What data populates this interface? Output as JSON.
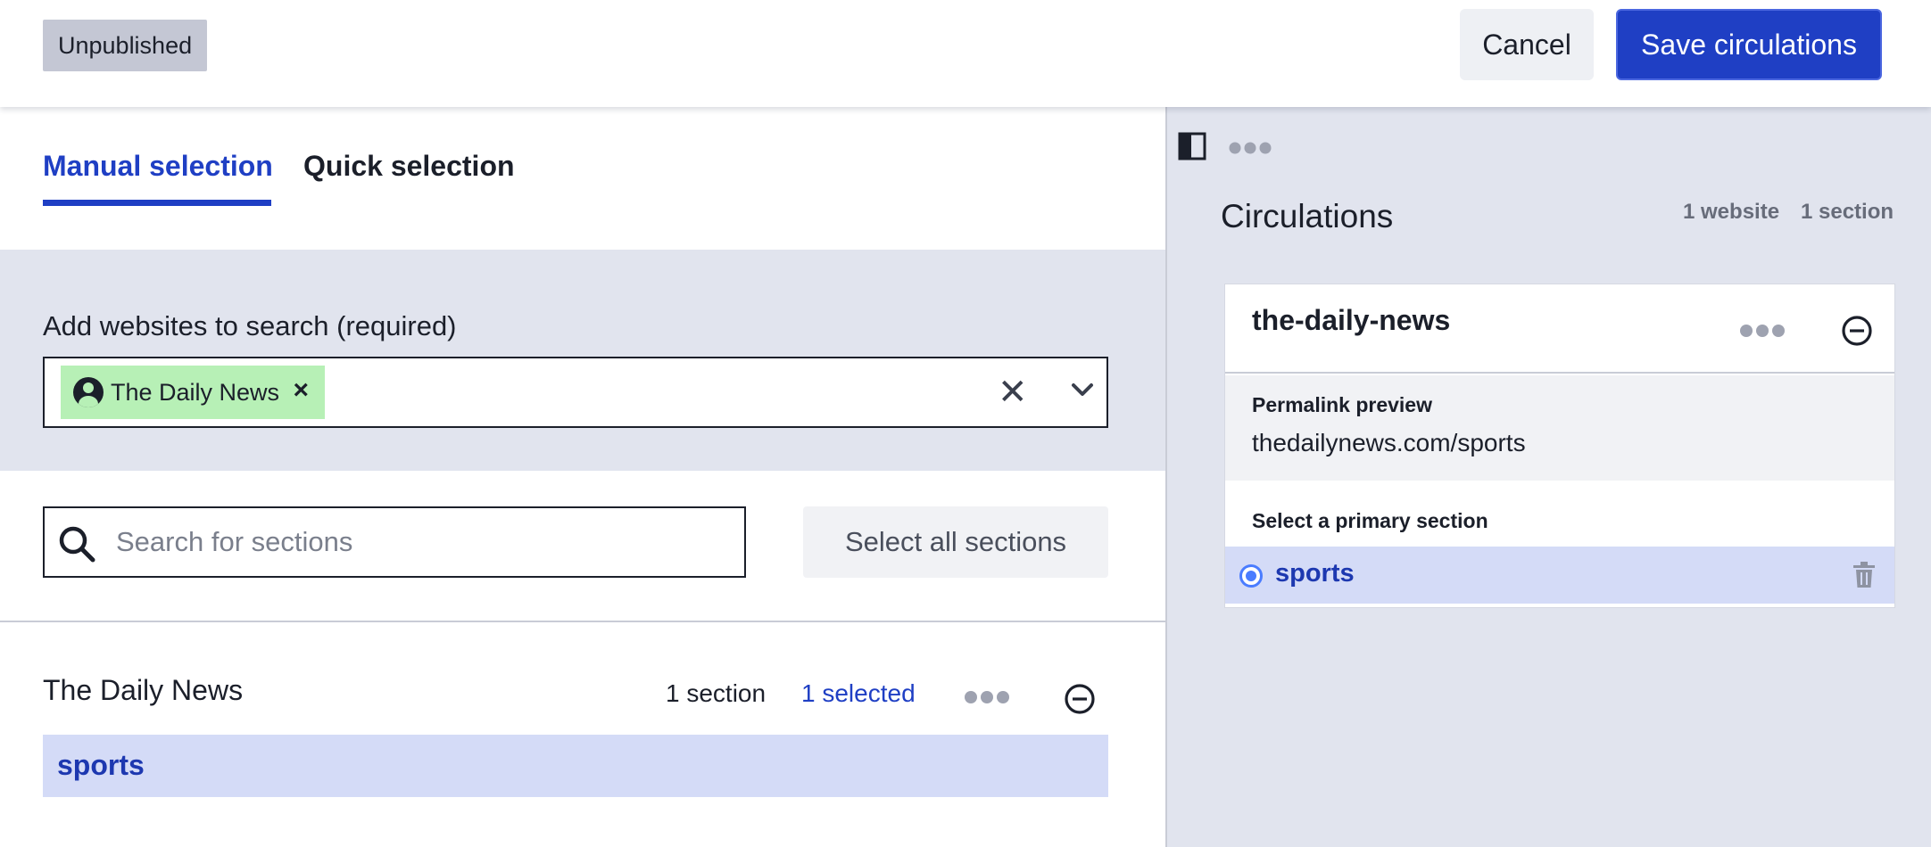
{
  "header": {
    "status": "Unpublished",
    "cancel_label": "Cancel",
    "save_label": "Save circulations"
  },
  "tabs": {
    "manual": "Manual selection",
    "quick": "Quick selection",
    "active": "manual"
  },
  "website_field": {
    "label": "Add websites to search (required)",
    "chips": [
      {
        "label": "The Daily News",
        "icon": "user-circle-icon",
        "color": "#b7f0b6"
      }
    ]
  },
  "section_search": {
    "placeholder": "Search for sections",
    "select_all_label": "Select all sections"
  },
  "site_group": {
    "name": "The Daily News",
    "section_count": "1 section",
    "selected_count": "1 selected",
    "sections": [
      "sports"
    ]
  },
  "circulations": {
    "title": "Circulations",
    "website_count": "1 website",
    "section_count": "1 section",
    "card": {
      "site": "the-daily-news",
      "permalink_label": "Permalink preview",
      "permalink_value": "thedailynews.com/sports",
      "primary_label": "Select a primary section",
      "primary_section": "sports"
    }
  },
  "colors": {
    "accent": "#1f3fc4",
    "selected_row": "#d4dbf7",
    "panel_bg": "#e1e4ee",
    "chip_bg": "#b7f0b6"
  }
}
